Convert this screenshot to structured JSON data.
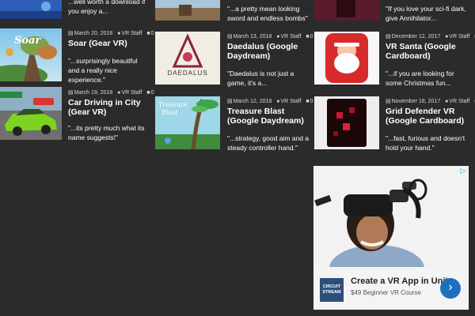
{
  "articles": [
    {
      "excerpt": "...well worth a download if you enjoy a..."
    },
    {
      "excerpt": "\"...a pretty mean looking sword and endless bombs\""
    },
    {
      "excerpt": "\"If you love your sci-fi dark, give Annihilator..."
    },
    {
      "date": "March 20, 2018",
      "author": "VR Staff",
      "comments": "0",
      "title": "Soar (Gear VR)",
      "excerpt": "\"...surprisingly beautiful and a really nice experience.\"",
      "thumb_text": "Soar"
    },
    {
      "date": "March 13, 2018",
      "author": "VR Staff",
      "comments": "0",
      "title": "Daedalus (Google Daydream)",
      "excerpt": "\"Daedalus is not just a game, it's a...",
      "thumb_text": "DAEDALUS"
    },
    {
      "date": "December 12, 2017",
      "author": "VR Staff",
      "comments": "0",
      "title": "VR Santa (Google Cardboard)",
      "excerpt": "\"...if you are looking for some Christmas fun..."
    },
    {
      "date": "March 19, 2018",
      "author": "VR Staff",
      "comments": "0",
      "title": "Car Driving in City (Gear VR)",
      "excerpt": "\"...its pretty much what its name suggests!\""
    },
    {
      "date": "March 12, 2018",
      "author": "VR Staff",
      "comments": "0",
      "title": "Treasure Blast (Google Daydream)",
      "excerpt": "\"...strategy, good aim and a steady controller hand.\"",
      "thumb_text_1": "Treasure",
      "thumb_text_2": "Blast"
    },
    {
      "date": "November 18, 2017",
      "author": "VR Staff",
      "comments": "0",
      "title": "Grid Defender VR (Google Cardboard)",
      "excerpt": "\"...fast, furious and doesn't hold your hand.\""
    }
  ],
  "icons": {
    "calendar": "calendar-icon",
    "user": "user-icon",
    "comment": "comment-icon"
  },
  "ad": {
    "logo_line1": "CIRCUIT",
    "logo_line2": "STREAM",
    "title": "Create a VR App in Unity",
    "subtitle": "$49 Beginner VR Course",
    "arrow": "›",
    "choices": "▷"
  },
  "colors": {
    "background": "#2b2b2b",
    "ad_button": "#1f6fbf",
    "ad_logo": "#2d4f7a"
  }
}
